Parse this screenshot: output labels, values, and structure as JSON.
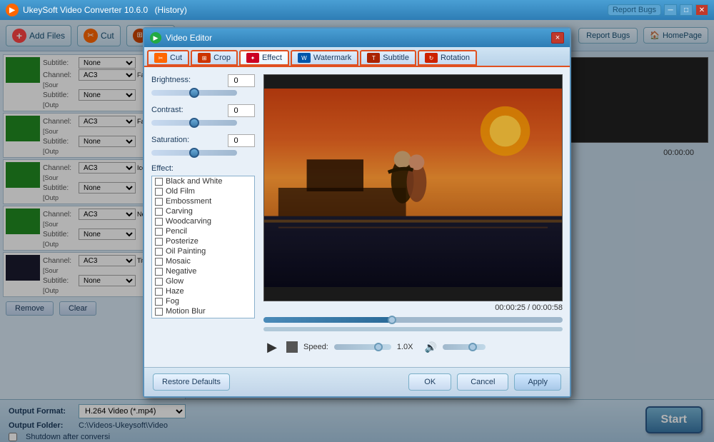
{
  "app": {
    "title": "UkeySoft Video Converter 10.6.0",
    "history_label": "(History)",
    "report_bugs": "Report Bugs",
    "homepage": "HomePage"
  },
  "toolbar": {
    "add_files": "Add Files",
    "cut": "Cut",
    "crop": "Crop"
  },
  "file_list": {
    "items": [
      {
        "channel": "AC3",
        "subtitle": "None",
        "source": "[Sour",
        "output": "[Outp"
      },
      {
        "channel": "AC3",
        "subtitle": "None",
        "source": "[Sour",
        "output": "[Outp"
      },
      {
        "channel": "AC3",
        "subtitle": "None",
        "source": "[Sour",
        "output": "[Outp"
      },
      {
        "channel": "AC3",
        "subtitle": "None",
        "source": "[Sour",
        "output": "[Outp"
      },
      {
        "channel": "AC3",
        "subtitle": "None",
        "source": "Titanic",
        "output": "[Outp"
      }
    ],
    "remove_btn": "Remove",
    "clear_btn": "Clear"
  },
  "bottom": {
    "output_format_label": "Output Format:",
    "output_format_value": "H.264 Video (*.mp4)",
    "output_folder_label": "Output Folder:",
    "output_folder_value": "C:\\Videos-Ukeysoft\\Video",
    "shutdown_label": "Shutdown after conversi",
    "start_btn": "Start"
  },
  "modal": {
    "title": "Video Editor",
    "close_btn": "×",
    "tabs": [
      {
        "label": "Cut",
        "active": false
      },
      {
        "label": "Crop",
        "active": false
      },
      {
        "label": "Effect",
        "active": true
      },
      {
        "label": "Watermark",
        "active": false
      },
      {
        "label": "Subtitle",
        "active": false
      },
      {
        "label": "Rotation",
        "active": false
      }
    ],
    "effect_tab": {
      "brightness_label": "Brightness:",
      "brightness_value": "0",
      "contrast_label": "Contrast:",
      "contrast_value": "0",
      "saturation_label": "Saturation:",
      "saturation_value": "0",
      "effect_label": "Effect:",
      "effects": [
        "Black and White",
        "Old Film",
        "Embossment",
        "Carving",
        "Woodcarving",
        "Pencil",
        "Posterize",
        "Oil Painting",
        "Mosaic",
        "Negative",
        "Glow",
        "Haze",
        "Fog",
        "Motion Blur"
      ]
    },
    "time_display": "00:00:25 / 00:00:58",
    "speed_label": "Speed:",
    "speed_value": "1.0X",
    "footer": {
      "restore_defaults": "Restore Defaults",
      "ok_btn": "OK",
      "cancel_btn": "Cancel",
      "apply_btn": "Apply"
    }
  }
}
